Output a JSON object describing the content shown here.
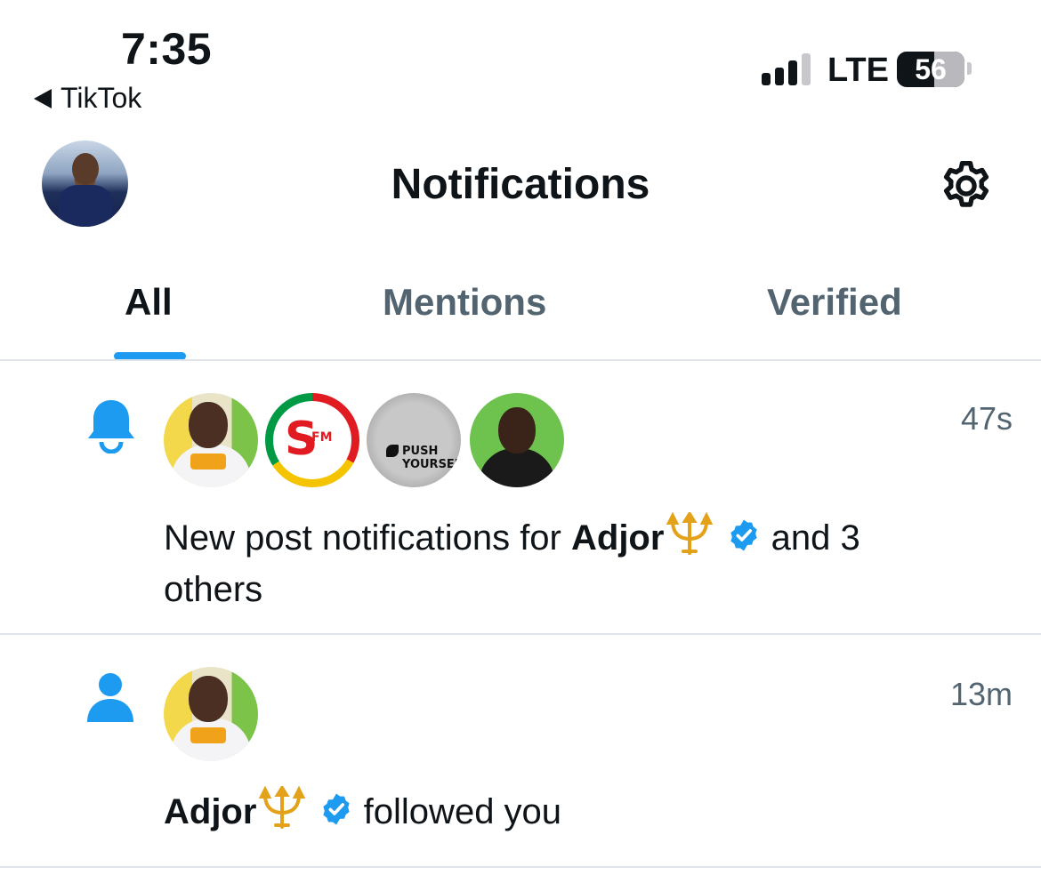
{
  "status_bar": {
    "time": "7:35",
    "back_app": "TikTok",
    "network": "LTE",
    "battery": "56",
    "battery_level_percent": 56
  },
  "header": {
    "title": "Notifications"
  },
  "tabs": [
    {
      "label": "All",
      "active": true
    },
    {
      "label": "Mentions",
      "active": false
    },
    {
      "label": "Verified",
      "active": false
    }
  ],
  "notifications": [
    {
      "type": "bell",
      "time": "47s",
      "text_prefix": "New post notifications for ",
      "name": "Adjor",
      "text_suffix_1": " and 3",
      "text_suffix_2": "others",
      "avatars": [
        "adjor",
        "sfm",
        "push-yourself",
        "green-portrait"
      ],
      "avatar_labels": [
        "",
        "S",
        "FM",
        "PUSH YOURSELF"
      ]
    },
    {
      "type": "follow",
      "time": "13m",
      "name": "Adjor",
      "text_suffix": " followed you",
      "avatars": [
        "adjor"
      ]
    }
  ],
  "colors": {
    "accent": "#1d9bf0",
    "text": "#0f1419",
    "secondary": "#536471",
    "divider": "#e1e4e8",
    "verified": "#1d9bf0",
    "trident": "#e3a21a"
  }
}
